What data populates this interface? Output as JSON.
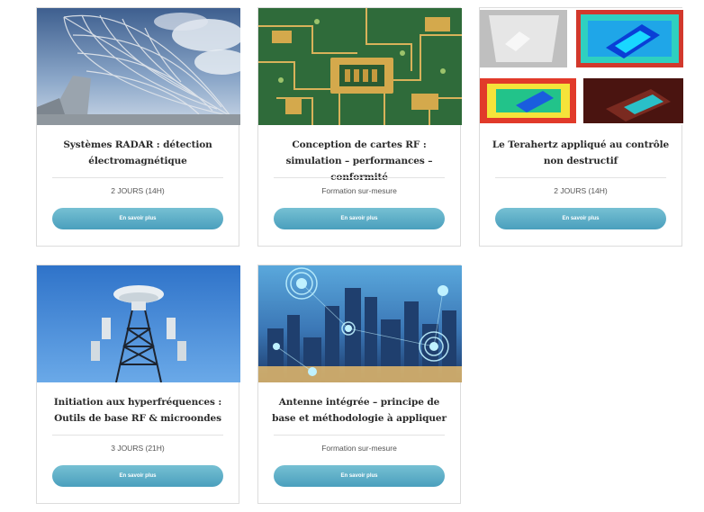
{
  "cards": [
    {
      "title": "Systèmes RADAR : détection électromagnétique",
      "duration": "2 JOURS (14H)",
      "button": "En savoir plus",
      "image": "radar-dish"
    },
    {
      "title": "Conception de cartes RF : simulation – performances – conformité",
      "duration": "Formation sur-mesure",
      "button": "En savoir plus",
      "image": "pcb-board"
    },
    {
      "title": "Le Terahertz appliqué au contrôle non destructif",
      "duration": "2 JOURS (14H)",
      "button": "En savoir plus",
      "image": "terahertz-scans"
    },
    {
      "title": "Initiation aux hyperfréquences : Outils de base RF & microondes",
      "duration": "3 JOURS (21H)",
      "button": "En savoir plus",
      "image": "antenna-tower"
    },
    {
      "title": "Antenne intégrée – principe de base et méthodologie à appliquer",
      "duration": "Formation sur-mesure",
      "button": "En savoir plus",
      "image": "smart-city"
    }
  ],
  "colors": {
    "button": "#5aaec9",
    "title": "#2b2b2b",
    "border": "#dcdcdc"
  }
}
